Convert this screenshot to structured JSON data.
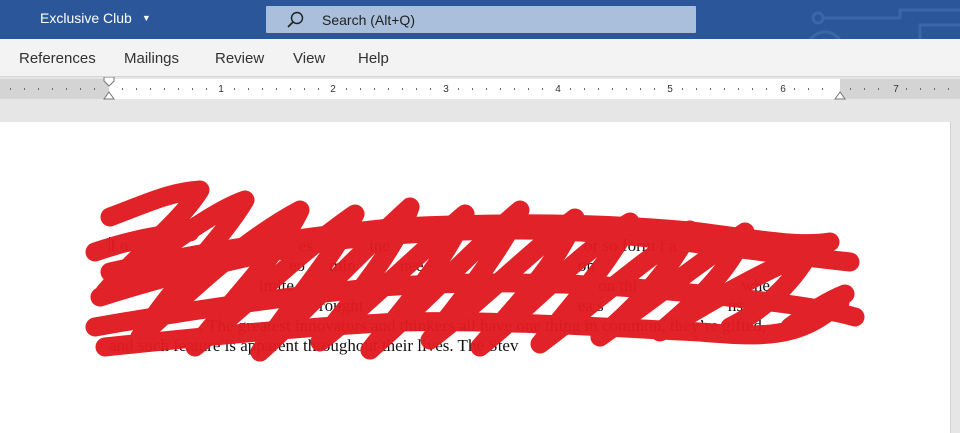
{
  "titlebar": {
    "doc_title": "Exclusive Club",
    "search_label": "Search (Alt+Q)",
    "brand_color": "#2b579a"
  },
  "ribbon": {
    "tabs": [
      {
        "label": "References"
      },
      {
        "label": "Mailings"
      },
      {
        "label": "Review"
      },
      {
        "label": "View"
      },
      {
        "label": "Help"
      }
    ]
  },
  "ruler": {
    "numbers": [
      "1",
      "2",
      "3",
      "4",
      "5",
      "6",
      "7"
    ]
  },
  "document": {
    "line1": "I o",
    "line2": "",
    "line3": "",
    "line4": "",
    "line5": ". The greatest innovators and thinkers all have one thing in common, they’re gifted,",
    "line6": "and such feature is apparent throughout their lives. The Stev",
    "fragments": {
      "a": "es",
      "b": "ine",
      "c": "or so",
      "d": "form",
      "e": "f a",
      "f": "eo",
      "g": "min",
      "h": "nee",
      "i": "on",
      "j": "on thi",
      "k": "whe",
      "l": "imite",
      "m": "rought",
      "n": "ea s",
      "o": "ns"
    },
    "redaction_color": "#e11b22"
  }
}
